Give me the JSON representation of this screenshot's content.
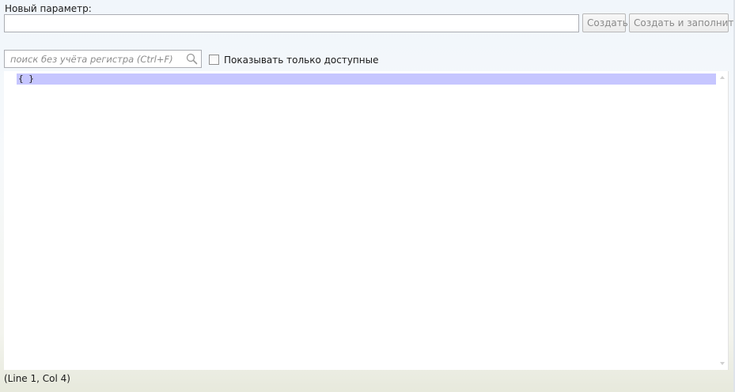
{
  "new_param": {
    "label": "Новый параметр:",
    "value": "",
    "create_label": "Создать",
    "create_fill_label": "Создать и заполнить"
  },
  "search": {
    "placeholder": "поиск без учёта регистра (Ctrl+F)",
    "icon": "search-icon"
  },
  "filter": {
    "show_available_label": "Показывать только доступные",
    "checked": false
  },
  "editor": {
    "lines": [
      "{ }"
    ]
  },
  "status": {
    "position": "(Line 1, Col 4)"
  },
  "colors": {
    "current_line": "#c6c6ff",
    "disabled_text": "#8a8a8a"
  }
}
